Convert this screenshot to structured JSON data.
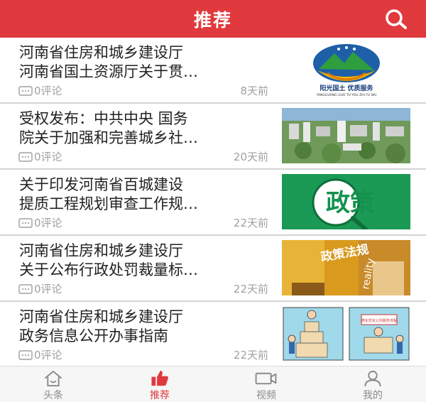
{
  "header": {
    "title": "推荐"
  },
  "articles": [
    {
      "line1": "河南省住房和城乡建设厅",
      "line2": "河南省国土资源厅关于贯…",
      "comments": "0评论",
      "time": "8天前",
      "thumb": {
        "icon": "sunshine-land-logo",
        "caption": "阳光国土 优质服务",
        "subcaption": "YANGGUANG GUO TU YOU ZHI FU WU"
      }
    },
    {
      "line1": "受权发布：中共中央 国务",
      "line2": "院关于加强和完善城乡社…",
      "comments": "0评论",
      "time": "20天前",
      "thumb": {
        "icon": "city-aerial-photo"
      }
    },
    {
      "line1": "关于印发河南省百城建设",
      "line2": "提质工程规划审查工作规…",
      "comments": "0评论",
      "time": "22天前",
      "thumb": {
        "icon": "policy-magnifier",
        "caption": "政策"
      }
    },
    {
      "line1": "河南省住房和城乡建设厅",
      "line2": "关于公布行政处罚裁量标…",
      "comments": "0评论",
      "time": "22天前",
      "thumb": {
        "icon": "policy-regulation-photo",
        "caption": "政策法规",
        "side_text": "reality"
      }
    },
    {
      "line1": "河南省住房和城乡建设厅",
      "line2": "政务信息公开办事指南",
      "comments": "0评论",
      "time": "22天前",
      "thumb": {
        "icon": "service-cartoon",
        "caption": "简化优化公共服务流程"
      }
    }
  ],
  "tabbar": {
    "items": [
      {
        "label": "头条",
        "icon": "home-icon",
        "active": false
      },
      {
        "label": "推荐",
        "icon": "thumbs-up-icon",
        "active": true
      },
      {
        "label": "视频",
        "icon": "video-icon",
        "active": false
      },
      {
        "label": "我的",
        "icon": "user-icon",
        "active": false
      }
    ]
  },
  "colors": {
    "brand": "#e0393e",
    "text": "#222222",
    "meta": "#a0a0a0",
    "tab_inactive": "#8a8a8a"
  }
}
